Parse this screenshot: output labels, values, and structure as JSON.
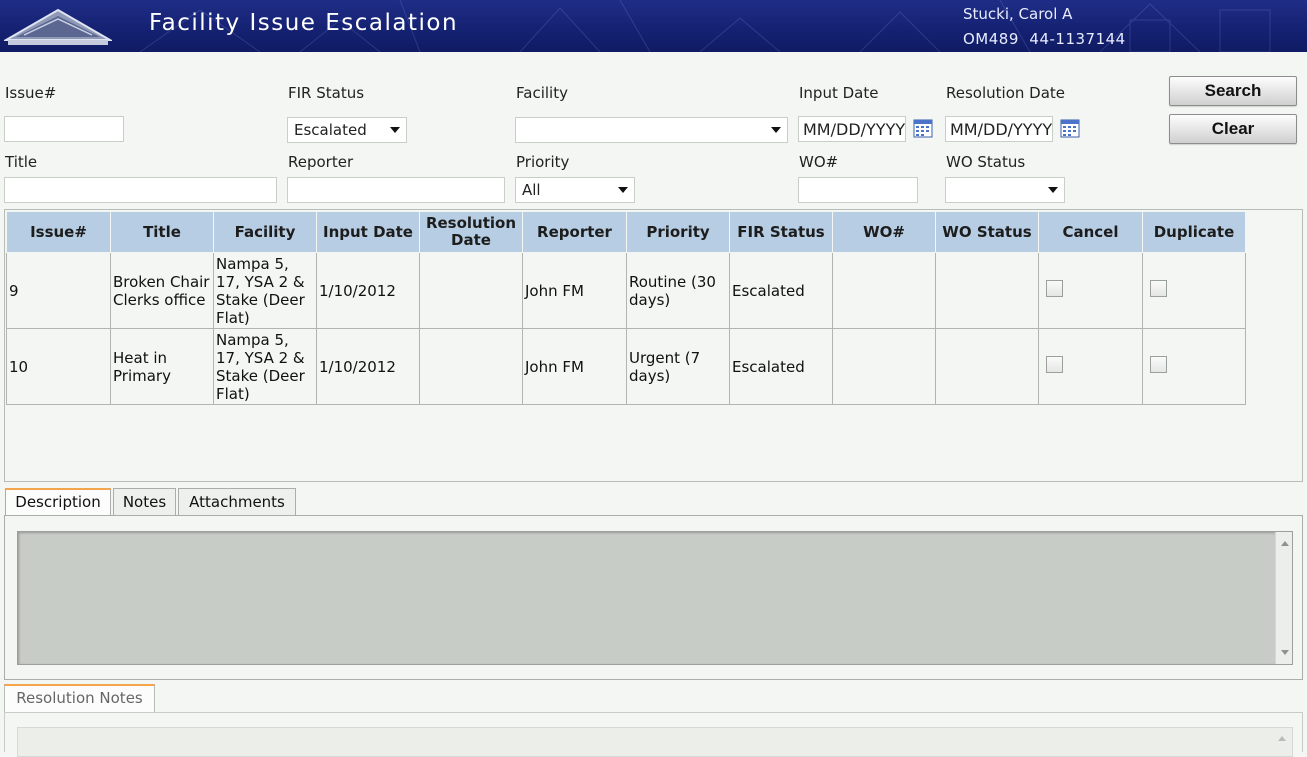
{
  "header": {
    "title": "Facility Issue Escalation",
    "user_name": "Stucki, Carol A",
    "user_code": "OM489  44-1137144"
  },
  "filters": {
    "issue_label": "Issue#",
    "issue_value": "",
    "fir_status_label": "FIR Status",
    "fir_status_value": "Escalated",
    "facility_label": "Facility",
    "facility_value": "",
    "input_date_label": "Input Date",
    "input_date_placeholder": "MM/DD/YYYY",
    "resolution_date_label": "Resolution Date",
    "resolution_date_placeholder": "MM/DD/YYYY",
    "title_label": "Title",
    "title_value": "",
    "reporter_label": "Reporter",
    "reporter_value": "",
    "priority_label": "Priority",
    "priority_value": "All",
    "wo_label": "WO#",
    "wo_value": "",
    "wo_status_label": "WO Status",
    "wo_status_value": ""
  },
  "buttons": {
    "search": "Search",
    "clear": "Clear"
  },
  "grid": {
    "columns": [
      "Issue#",
      "Title",
      "Facility",
      "Input Date",
      "Resolution Date",
      "Reporter",
      "Priority",
      "FIR Status",
      "WO#",
      "WO Status",
      "Cancel",
      "Duplicate"
    ],
    "rows": [
      {
        "issue": "9",
        "title": "Broken Chair Clerks office",
        "facility": "Nampa 5, 17, YSA 2 & Stake (Deer Flat)",
        "input_date": "1/10/2012",
        "resolution_date": "",
        "reporter": "John FM",
        "priority": "Routine (30 days)",
        "fir_status": "Escalated",
        "wo": "",
        "wo_status": "",
        "cancel": false,
        "duplicate": false
      },
      {
        "issue": "10",
        "title": "Heat in Primary",
        "facility": "Nampa 5, 17, YSA 2 & Stake (Deer Flat)",
        "input_date": "1/10/2012",
        "resolution_date": "",
        "reporter": "John FM",
        "priority": "Urgent (7 days)",
        "fir_status": "Escalated",
        "wo": "",
        "wo_status": "",
        "cancel": false,
        "duplicate": false
      }
    ]
  },
  "tabs": [
    {
      "label": "Description",
      "active": true
    },
    {
      "label": "Notes",
      "active": false
    },
    {
      "label": "Attachments",
      "active": false
    }
  ],
  "description": "",
  "resolution_tab": {
    "label": "Resolution Notes"
  },
  "colors": {
    "header_bg": "#152273",
    "grid_header_bg": "#b7cde3",
    "tab_accent": "#f2a54a"
  },
  "icons": {
    "logo": "temple-roof-logo",
    "calendar": "calendar-icon",
    "dropdown": "chevron-down-icon"
  }
}
